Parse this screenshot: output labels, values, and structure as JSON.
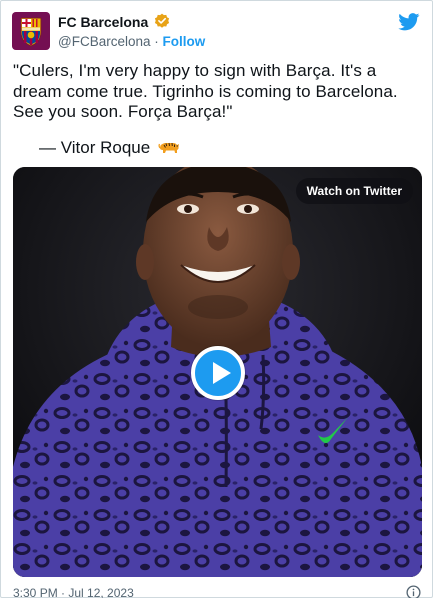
{
  "account": {
    "name": "FC Barcelona",
    "handle": "@FCBarcelona",
    "separator": "·",
    "follow_label": "Follow",
    "verified_color": "#E8A317"
  },
  "tweet": {
    "text": "\"Culers, I'm very happy to sign with Barça. It's a dream come true. Tigrinho is coming to Barcelona. See you soon. Força Barça!\"",
    "signature": "— Vitor Roque"
  },
  "media": {
    "type": "video",
    "watch_label": "Watch on Twitter",
    "play_color": "#1D9BF0"
  },
  "footer": {
    "timestamp": "3:30 PM · Jul 12, 2023"
  },
  "icons": {
    "brand": "twitter-bird-icon",
    "info": "info-icon",
    "emoji": "tiger-emoji-icon"
  },
  "colors": {
    "accent": "#1D9BF0",
    "text": "#0F1419",
    "muted": "#536471",
    "hoodie": "#4B3FA6"
  }
}
